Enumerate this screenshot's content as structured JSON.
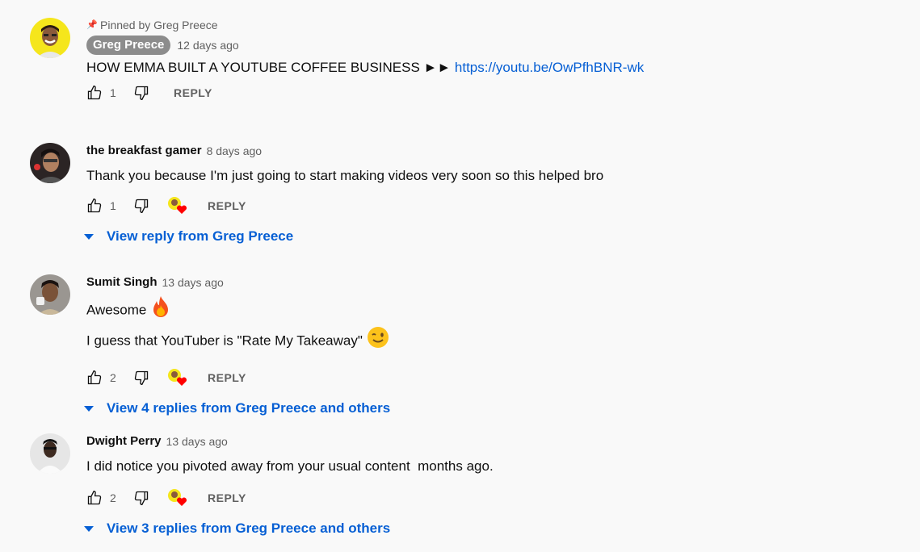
{
  "comments": [
    {
      "pinned_text": "Pinned by Greg Preece",
      "author": "Greg Preece",
      "time": "12 days ago",
      "text": "HOW EMMA BUILT A YOUTUBE COFFEE BUSINESS ►► ",
      "link": "https://youtu.be/OwPfhBNR-wk",
      "likes": "1",
      "reply_label": "REPLY",
      "avatar_icon": "person-yellow-bg-avatar"
    },
    {
      "author": "the breakfast gamer",
      "time": "8 days ago",
      "text": "Thank you because I'm just going to start making videos very soon so this helped bro",
      "likes": "1",
      "reply_label": "REPLY",
      "view_replies": "View reply from Greg Preece",
      "avatar_icon": "person-dark-avatar"
    },
    {
      "author": "Sumit Singh",
      "time": "13 days ago",
      "text_line1": "Awesome ",
      "text_line2": "I guess that YouTuber is \"Rate My Takeaway\" ",
      "emoji1": "fire-emoji",
      "emoji2": "winking-face-emoji",
      "likes": "2",
      "reply_label": "REPLY",
      "view_replies": "View 4 replies from Greg Preece and others",
      "avatar_icon": "person-grey-avatar"
    },
    {
      "author": "Dwight Perry",
      "time": "13 days ago",
      "text": "I did notice you pivoted away from your usual content  months ago.",
      "likes": "2",
      "reply_label": "REPLY",
      "view_replies": "View 3 replies from Greg Preece and others",
      "avatar_icon": "person-light-avatar"
    }
  ],
  "colors": {
    "background": "#f9f9f9",
    "link": "#065fd4",
    "secondary_text": "#606060",
    "author_badge": "#8c8c8c",
    "heart": "#ff0000"
  }
}
